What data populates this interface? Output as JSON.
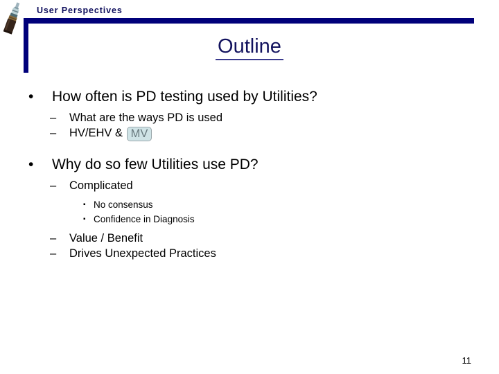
{
  "header": {
    "banner_title": "User Perspectives",
    "icon": "coaxial-cable-icon",
    "accent_color": "#00007a"
  },
  "title": {
    "text": "Outline",
    "color": "#12125e"
  },
  "outline": {
    "items": [
      {
        "level": 1,
        "marker": "•",
        "text": "How often is PD testing used by Utilities?"
      },
      {
        "level": 2,
        "marker": "–",
        "text": "What are the ways PD is used"
      },
      {
        "level": 2,
        "marker": "–",
        "text_before": "HV/EHV &",
        "selected_token": "MV"
      },
      {
        "level": 1,
        "marker": "•",
        "text": "Why do so few Utilities use PD?"
      },
      {
        "level": 2,
        "marker": "–",
        "text": "Complicated"
      },
      {
        "level": 3,
        "marker": "▪",
        "text": "No consensus"
      },
      {
        "level": 3,
        "marker": "▪",
        "text": "Confidence in Diagnosis"
      },
      {
        "level": 2,
        "marker": "–",
        "text": "Value / Benefit"
      },
      {
        "level": 2,
        "marker": "–",
        "text": "Drives Unexpected Practices"
      }
    ]
  },
  "footer": {
    "page_number": "11"
  },
  "selection": {
    "fill_color": "#cfe3e6",
    "border_color": "#9aa7ab",
    "text_color": "#68797e"
  }
}
